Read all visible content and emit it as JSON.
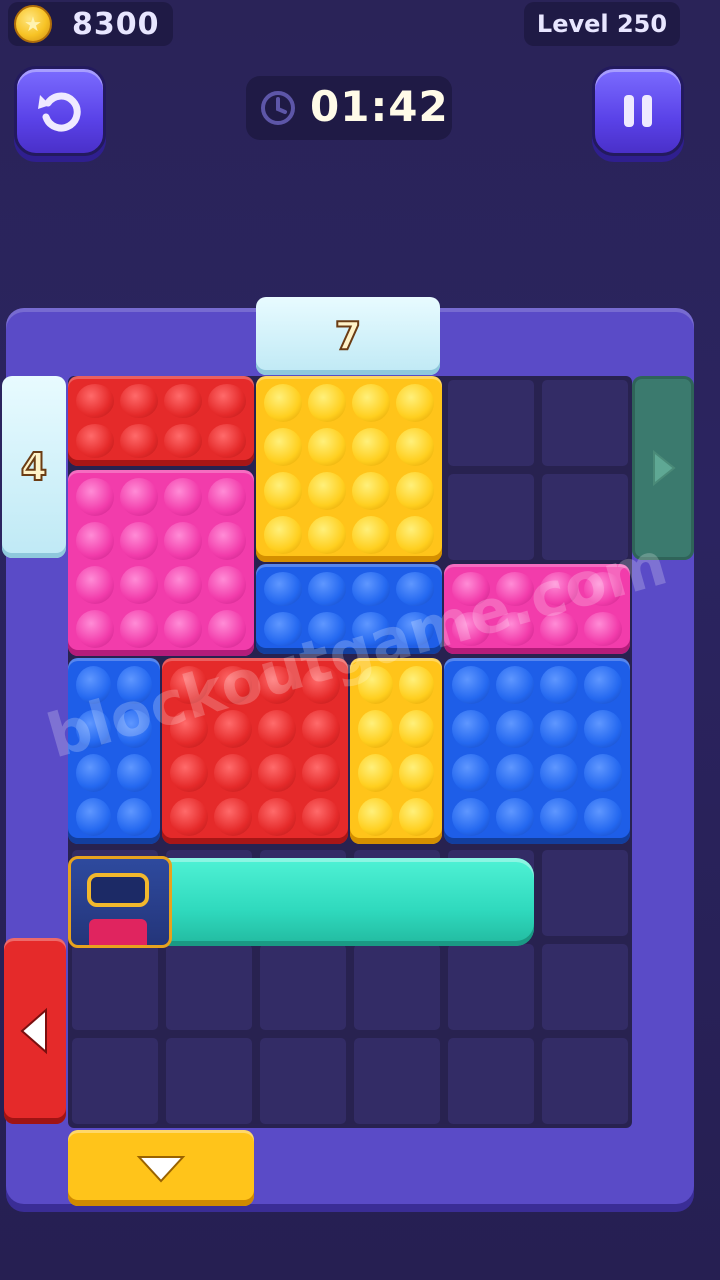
{
  "hud": {
    "coins": "8300",
    "level": "Level 250",
    "timer": "01:42"
  },
  "gates": {
    "top_number": "7",
    "left_number": "4"
  },
  "watermark": "blockoutgame.com",
  "colors": {
    "red": "#e52a2a",
    "pink": "#f23cab",
    "yellow": "#ffc41a",
    "blue": "#1e5ee8",
    "slime": "#2fd9bd",
    "frame": "#5a4bc7"
  },
  "blocks": [
    {
      "name": "red-block-top",
      "color": "red",
      "studs": "4x2"
    },
    {
      "name": "yellow-block-large",
      "color": "yellow",
      "studs": "4x4"
    },
    {
      "name": "pink-block-left",
      "color": "pink",
      "studs": "4x4"
    },
    {
      "name": "blue-block-middle",
      "color": "blue",
      "studs": "4x2"
    },
    {
      "name": "pink-block-right",
      "color": "pink",
      "studs": "4x2"
    },
    {
      "name": "blue-block-left",
      "color": "blue",
      "studs": "2x4"
    },
    {
      "name": "red-block-center",
      "color": "red",
      "studs": "4x4"
    },
    {
      "name": "yellow-block-narrow",
      "color": "yellow",
      "studs": "2x4"
    },
    {
      "name": "blue-block-right",
      "color": "blue",
      "studs": "4x4"
    }
  ]
}
